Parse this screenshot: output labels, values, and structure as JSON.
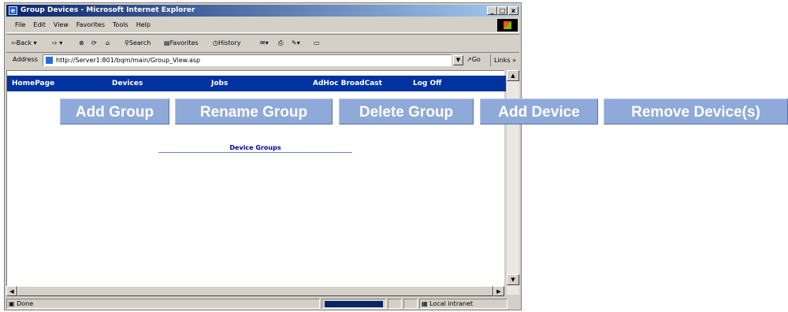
{
  "window": {
    "title": "Group Devices - Microsoft Internet Explorer",
    "controls": {
      "minimize": "_",
      "maximize": "□",
      "close": "x"
    }
  },
  "menu": [
    "File",
    "Edit",
    "View",
    "Favorites",
    "Tools",
    "Help"
  ],
  "toolbar": {
    "back": "Back",
    "search": "Search",
    "favorites": "Favorites",
    "history": "History"
  },
  "address": {
    "label": "Address",
    "url": "http://Server1:801/bqm/main/Group_View.asp",
    "go": "Go",
    "links": "Links"
  },
  "nav": [
    "HomePage",
    "Devices",
    "Jobs",
    "AdHoc BroadCast",
    "Log Off"
  ],
  "actions": [
    "Add Group",
    "Rename Group",
    "Delete Group",
    "Add Device",
    "Remove Device(s)"
  ],
  "content": {
    "groups_header": "Device Groups"
  },
  "status": {
    "text": "Done",
    "zone": "Local intranet"
  },
  "colors": {
    "nav_bg": "#0033a0",
    "button_bg": "#8fa9d8",
    "title_start": "#0a246a"
  }
}
